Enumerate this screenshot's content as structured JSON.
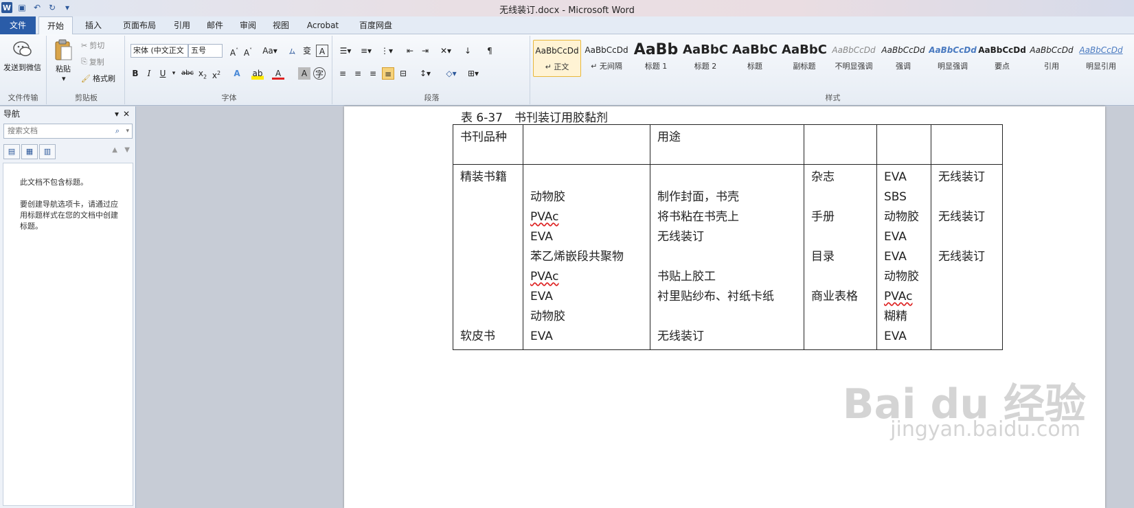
{
  "window": {
    "title": "无线装订.docx - Microsoft Word"
  },
  "tabs": [
    "文件",
    "开始",
    "插入",
    "页面布局",
    "引用",
    "邮件",
    "审阅",
    "视图",
    "Acrobat",
    "百度网盘"
  ],
  "ribbon": {
    "groups": {
      "send": "文件传输",
      "clipboard": "剪贴板",
      "font": "字体",
      "paragraph": "段落",
      "styles": "样式"
    },
    "send_label": "发送到微信",
    "paste_label": "粘贴",
    "cut_label": "剪切",
    "copy_label": "复制",
    "format_painter_label": "格式刷",
    "font_name": "宋体 (中文正文",
    "font_size": "五号",
    "styles": [
      {
        "sample": "AaBbCcDd",
        "name": "↵ 正文"
      },
      {
        "sample": "AaBbCcDd",
        "name": "↵ 无间隔"
      },
      {
        "sample": "AaBb",
        "name": "标题 1"
      },
      {
        "sample": "AaBbC",
        "name": "标题 2"
      },
      {
        "sample": "AaBbC",
        "name": "标题"
      },
      {
        "sample": "AaBbC",
        "name": "副标题"
      },
      {
        "sample": "AaBbCcDd",
        "name": "不明显强调"
      },
      {
        "sample": "AaBbCcDd",
        "name": "强调"
      },
      {
        "sample": "AaBbCcDd",
        "name": "明显强调"
      },
      {
        "sample": "AaBbCcDd",
        "name": "要点"
      },
      {
        "sample": "AaBbCcDd",
        "name": "引用"
      },
      {
        "sample": "AaBbCcDd",
        "name": "明显引用"
      }
    ]
  },
  "nav": {
    "title": "导航",
    "search_placeholder": "搜索文档",
    "msg1": "此文档不包含标题。",
    "msg2": "要创建导航选项卡，请通过应用标题样式在您的文档中创建标题。"
  },
  "document": {
    "caption": "表 6-37　书刊装订用胶黏剂",
    "header": [
      "书刊品种",
      "",
      "用途",
      "",
      "",
      ""
    ],
    "col1": [
      "精装书籍",
      "",
      "",
      "",
      "",
      "",
      "",
      "",
      "软皮书"
    ],
    "col2": [
      "",
      "动物胶",
      "PVAc",
      "EVA",
      "苯乙烯嵌段共聚物",
      "PVAc",
      "EVA",
      "动物胶",
      "EVA"
    ],
    "col3": [
      "",
      "制作封面，书壳",
      "将书粘在书壳上",
      "无线装订",
      "",
      "书贴上胶工",
      "衬里贴纱布、衬纸卡纸",
      "",
      "无线装订"
    ],
    "col4": [
      "杂志",
      "",
      "手册",
      "",
      "目录",
      "",
      "商业表格",
      "",
      ""
    ],
    "col5": [
      "EVA",
      "SBS",
      "动物胶",
      "EVA",
      "EVA",
      "动物胶",
      "PVAc",
      "糊精",
      "EVA"
    ],
    "col6": [
      "无线装订",
      "",
      "无线装订",
      "",
      "无线装订",
      "",
      "",
      "",
      ""
    ]
  },
  "watermark": {
    "line1": "Bai du 经验",
    "line2": "jingyan.baidu.com"
  }
}
